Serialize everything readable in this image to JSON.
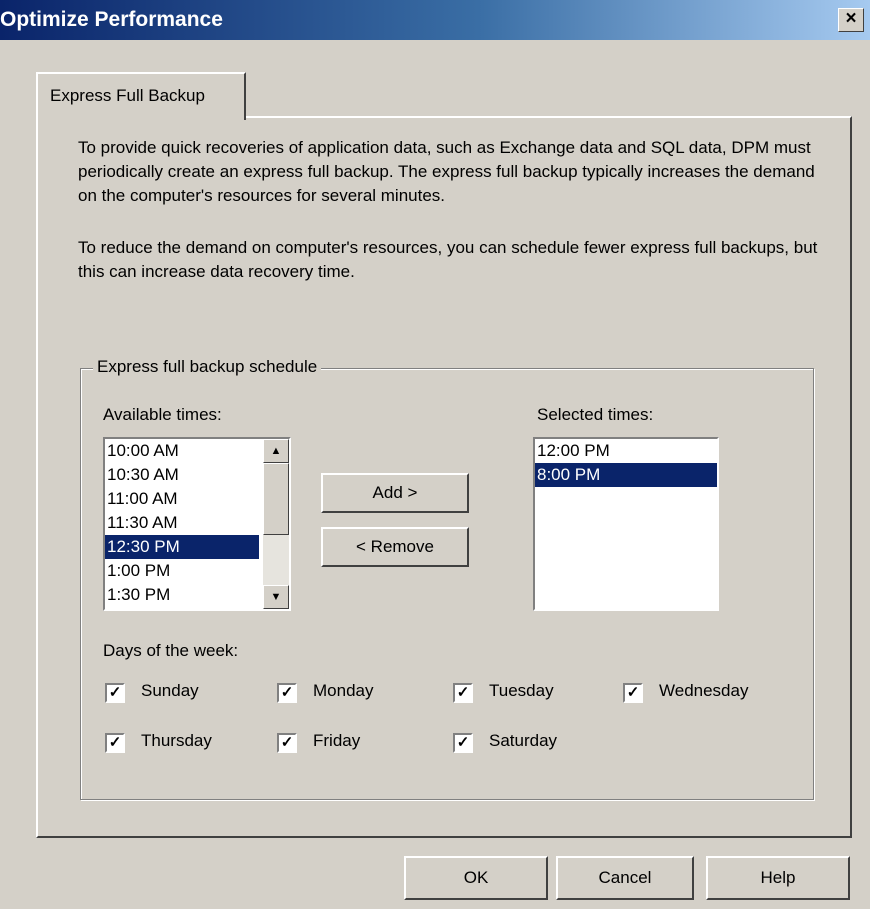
{
  "window": {
    "title": "Optimize Performance",
    "close_glyph": "×"
  },
  "tab": {
    "label": "Express Full Backup"
  },
  "description": {
    "para1": "To provide quick recoveries of application data, such as Exchange data and SQL data, DPM must periodically create an express full backup. The express full backup typically increases the demand on the computer's resources for several minutes.",
    "para2": "To reduce the demand on computer's resources, you can schedule fewer express full backups, but this can increase data recovery time."
  },
  "schedule": {
    "group_title": "Express full backup schedule",
    "available_label": "Available times:",
    "selected_label": "Selected times:",
    "available_times": [
      "10:00 AM",
      "10:30 AM",
      "11:00 AM",
      "11:30 AM",
      "12:30 PM",
      "1:00 PM",
      "1:30 PM"
    ],
    "available_selected_index": 4,
    "selected_times": [
      "12:00 PM",
      "8:00 PM"
    ],
    "selected_selected_index": 1,
    "add_label": "Add >",
    "remove_label": "< Remove",
    "days_label": "Days of the week:",
    "days": [
      {
        "label": "Sunday",
        "checked": true
      },
      {
        "label": "Monday",
        "checked": true
      },
      {
        "label": "Tuesday",
        "checked": true
      },
      {
        "label": "Wednesday",
        "checked": true
      },
      {
        "label": "Thursday",
        "checked": true
      },
      {
        "label": "Friday",
        "checked": true
      },
      {
        "label": "Saturday",
        "checked": true
      }
    ],
    "check_glyph": "✓"
  },
  "buttons": {
    "ok": "OK",
    "cancel": "Cancel",
    "help": "Help"
  },
  "scroll_glyphs": {
    "up": "▲",
    "down": "▼"
  },
  "colors": {
    "selection": "#0a246a",
    "dialog_face": "#d4d0c8"
  }
}
